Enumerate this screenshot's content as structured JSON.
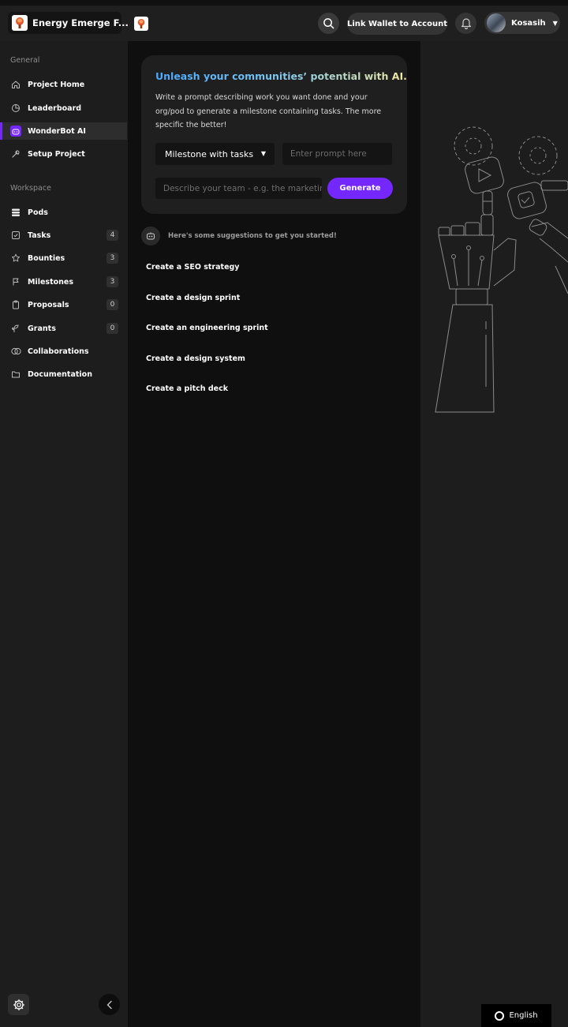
{
  "header": {
    "org_name": "Energy Emerge F...",
    "wallet_button": "Link Wallet to Account",
    "user_name": "Kosasih"
  },
  "sidebar": {
    "general_label": "General",
    "general_items": [
      {
        "label": "Project Home",
        "icon": "home-icon"
      },
      {
        "label": "Leaderboard",
        "icon": "pie-chart-icon"
      },
      {
        "label": "WonderBot AI",
        "icon": "robot-icon",
        "active": true
      },
      {
        "label": "Setup Project",
        "icon": "wrench-icon"
      }
    ],
    "workspace_label": "Workspace",
    "workspace_items": [
      {
        "label": "Pods",
        "icon": "stack-icon"
      },
      {
        "label": "Tasks",
        "icon": "checkbox-icon",
        "count": "4"
      },
      {
        "label": "Bounties",
        "icon": "star-icon",
        "count": "3"
      },
      {
        "label": "Milestones",
        "icon": "flag-icon",
        "count": "3"
      },
      {
        "label": "Proposals",
        "icon": "clipboard-icon",
        "count": "0"
      },
      {
        "label": "Grants",
        "icon": "sprout-icon",
        "count": "0"
      },
      {
        "label": "Collaborations",
        "icon": "overlap-circles-icon"
      },
      {
        "label": "Documentation",
        "icon": "folder-icon"
      }
    ]
  },
  "prompt_card": {
    "title": "Unleash your communities’ potential with AI.",
    "description": "Write a prompt describing work you want done and your org/pod to generate a milestone containing tasks. The more specific the better!",
    "select_value": "Milestone with tasks",
    "prompt_placeholder": "Enter prompt here",
    "team_placeholder": "Describe your team - e.g. the marketing team",
    "generate_label": "Generate"
  },
  "suggestions": {
    "intro": "Here's some suggestions to get you started!",
    "items": [
      "Create a SEO strategy",
      "Create a design sprint",
      "Create an engineering sprint",
      "Create a design system",
      "Create a pitch deck"
    ]
  },
  "footer": {
    "language": "English"
  },
  "colors": {
    "accent": "#7427ff",
    "panel": "#1f1f1f",
    "main_bg": "#0f0f0f"
  }
}
